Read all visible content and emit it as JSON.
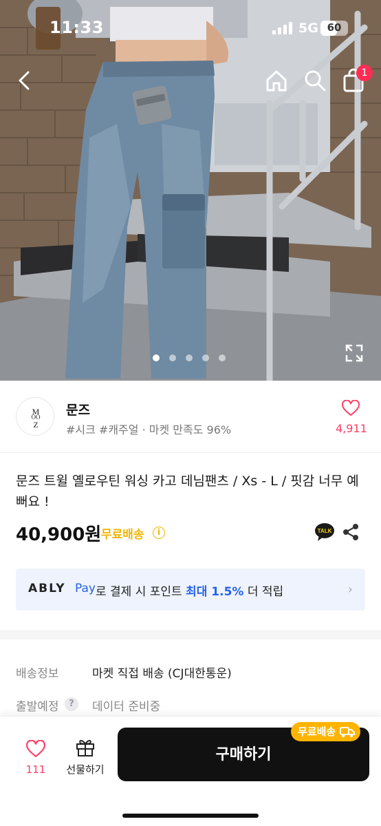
{
  "status_bar": {
    "time": "11:33",
    "network": "5G",
    "battery": "60",
    "battery_level": 0.6
  },
  "icons": {
    "back": "chevron-left-icon",
    "home": "home-icon",
    "search": "search-icon",
    "cart": "shopping-bag-icon",
    "expand": "expand-icon",
    "heart": "heart-icon",
    "gift": "gift-icon",
    "talk": "kakao-talk-icon",
    "share": "share-icon",
    "truck": "truck-icon"
  },
  "header": {
    "cart_count": "1"
  },
  "gallery": {
    "dot_count": 5,
    "active_index": 0
  },
  "shop": {
    "name": "문즈",
    "tags": "#시크 #캐주얼 · 마켓 만족도 96%",
    "like_count": "4,911",
    "logo_text": "MOOZ"
  },
  "product": {
    "title": "문즈 트윌 옐로우틴 워싱 카고 데님팬츠 / Xs - L / 핏감 너무 예뻐요 !",
    "price": "40,900원",
    "free_shipping": "무료배송",
    "info_icon": "i",
    "talk_label": "TALK"
  },
  "pay_banner": {
    "brand": "ABLY",
    "pay": "Pay",
    "text_before": "로 결제 시 포인트 ",
    "highlight": "최대 1.5%",
    "text_after": " 더 적립",
    "chevron": "›"
  },
  "delivery": {
    "shipping_label": "배송정보",
    "shipping_value": "마켓 직접 배송 (CJ대한통운)",
    "dispatch_label": "출발예정",
    "help_icon": "?",
    "dispatch_value": "데이터 준비중"
  },
  "bottom_bar": {
    "like_count": "111",
    "gift_label": "선물하기",
    "buy_label": "구매하기",
    "badge_label": "무료배송"
  },
  "colors": {
    "accent_pink": "#ff3c64",
    "free_shipping_yellow": "#f2b705",
    "ably_blue": "#2563eb",
    "buy_button": "#111111",
    "badge_orange": "#ffb400"
  }
}
